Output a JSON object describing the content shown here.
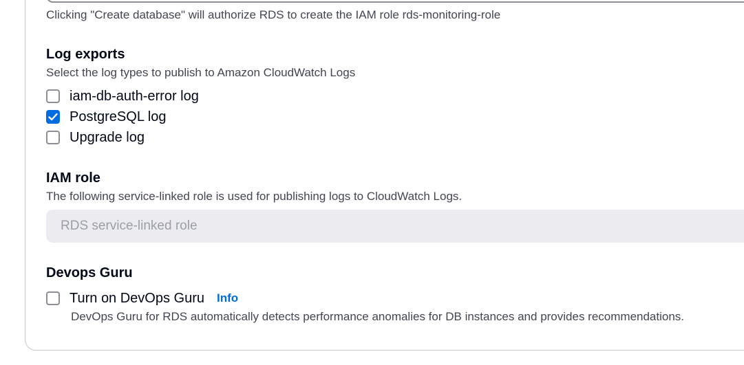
{
  "monitoring": {
    "helper_text": "Clicking \"Create database\" will authorize RDS to create the IAM role rds-monitoring-role"
  },
  "log_exports": {
    "title": "Log exports",
    "description": "Select the log types to publish to Amazon CloudWatch Logs",
    "options": [
      {
        "label": "iam-db-auth-error log",
        "checked": false
      },
      {
        "label": "PostgreSQL log",
        "checked": true
      },
      {
        "label": "Upgrade log",
        "checked": false
      }
    ]
  },
  "iam_role": {
    "title": "IAM role",
    "description": "The following service-linked role is used for publishing logs to CloudWatch Logs.",
    "placeholder": "RDS service-linked role"
  },
  "devops_guru": {
    "title": "Devops Guru",
    "option_label": "Turn on DevOps Guru",
    "checked": false,
    "info_label": "Info",
    "description": "DevOps Guru for RDS automatically detects performance anomalies for DB instances and provides recommendations."
  },
  "icons": {
    "checkmark": "check-icon"
  },
  "colors": {
    "accent": "#006ce0",
    "text": "#000716",
    "secondary_text": "#424650",
    "disabled_bg": "#ebebf0",
    "disabled_text": "#9ba0a8",
    "border": "#8c8c94"
  }
}
